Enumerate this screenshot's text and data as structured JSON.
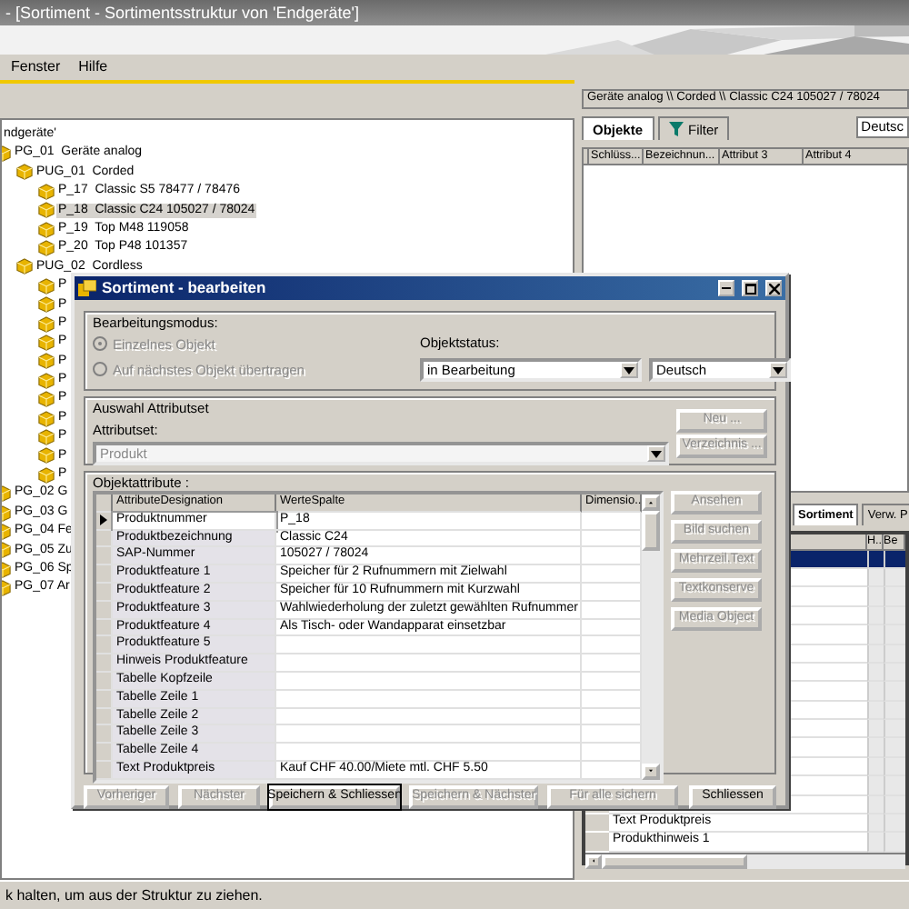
{
  "window": {
    "title": "- [Sortiment - Sortimentsstruktur von 'Endgeräte']"
  },
  "menu": [
    {
      "label": "Fenster"
    },
    {
      "label": "Hilfe"
    }
  ],
  "tree": {
    "header": "ndgeräte'",
    "items": [
      {
        "label": "PG_01  Geräte analog",
        "selected": false,
        "children": [
          {
            "label": "PUG_01  Corded",
            "selected": false,
            "children": [
              {
                "label": "P_17  Classic S5 78477 / 78476",
                "selected": false
              },
              {
                "label": "P_18  Classic C24 105027 / 78024",
                "selected": true
              },
              {
                "label": "P_19  Top M48 119058",
                "selected": false
              },
              {
                "label": "P_20  Top P48 101357",
                "selected": false
              }
            ]
          },
          {
            "label": "PUG_02  Cordless",
            "selected": false,
            "children": [
              {
                "label": "P",
                "selected": false
              },
              {
                "label": "P",
                "selected": false
              },
              {
                "label": "P",
                "selected": false
              },
              {
                "label": "P",
                "selected": false
              },
              {
                "label": "P",
                "selected": false
              },
              {
                "label": "P",
                "selected": false
              },
              {
                "label": "P",
                "selected": false
              },
              {
                "label": "P",
                "selected": false
              },
              {
                "label": "P",
                "selected": false
              },
              {
                "label": "P",
                "selected": false
              },
              {
                "label": "P",
                "selected": false
              }
            ]
          }
        ]
      },
      {
        "label": "PG_02 G",
        "selected": false
      },
      {
        "label": "PG_03 G",
        "selected": false
      },
      {
        "label": "PG_04 Fe",
        "selected": false
      },
      {
        "label": "PG_05 Zu",
        "selected": false
      },
      {
        "label": "PG_06 Sp",
        "selected": false
      },
      {
        "label": "PG_07 Ar",
        "selected": false
      }
    ]
  },
  "objects_panel": {
    "path": "Geräte analog \\\\ Corded \\\\ Classic C24 105027 / 78024",
    "tabs": [
      {
        "label": "Objekte",
        "selected": true
      },
      {
        "label": "Filter",
        "selected": false
      }
    ],
    "language": "Deutsc",
    "columns": [
      "Schlüss...",
      "Bezeichnun...",
      "Attribut 3",
      "Attribut 4"
    ]
  },
  "attributes_panel": {
    "tabs": [
      {
        "label": "Sortiment",
        "selected": true
      },
      {
        "label": "Verw. P",
        "selected": false
      }
    ],
    "columns": [
      "H..",
      "Be"
    ],
    "rows": [
      {
        "selected": true
      },
      {
        "selected": false
      },
      {
        "selected": false
      },
      {
        "selected": false
      },
      {
        "selected": false
      },
      {
        "selected": false
      },
      {
        "selected": false
      },
      {
        "selected": false
      },
      {
        "selected": false
      },
      {
        "selected": false
      },
      {
        "selected": false
      },
      {
        "selected": false
      },
      {
        "selected": false
      },
      {
        "selected": false
      },
      {
        "text": "Text Produktpreis",
        "selected": false
      },
      {
        "text": "Produkthinweis 1",
        "selected": false
      }
    ]
  },
  "dialog": {
    "title": "Sortiment - bearbeiten",
    "mode": {
      "legend": "Bearbeitungsmodus:",
      "options": [
        {
          "label": "Einzelnes Objekt",
          "selected": true,
          "disabled": true
        },
        {
          "label": "Auf nächstes Objekt übertragen",
          "selected": false,
          "disabled": true
        }
      ]
    },
    "status": {
      "label": "Objektstatus:",
      "value": "in Bearbeitung"
    },
    "language": {
      "value": "Deutsch"
    },
    "attributset": {
      "legend": "Auswahl Attributset",
      "label": "Attributset:",
      "value": "Produkt",
      "disabled": true,
      "buttons": [
        {
          "label": "Neu ...",
          "disabled": true
        },
        {
          "label": "Verzeichnis ...",
          "disabled": true
        }
      ]
    },
    "attributes": {
      "legend": "Objektattribute :",
      "columns": [
        "AttributeDesignation",
        "WerteSpalte",
        "Dimensio.."
      ],
      "rows": [
        {
          "name": "Produktnummer",
          "value": "P_18",
          "current": true
        },
        {
          "name": "Produktbezeichnung",
          "value": "Classic C24",
          "current": false
        },
        {
          "name": "SAP-Nummer",
          "value": "105027 / 78024",
          "current": false
        },
        {
          "name": "Produktfeature 1",
          "value": "Speicher für 2 Rufnummern mit Zielwahl",
          "current": false
        },
        {
          "name": "Produktfeature 2",
          "value": "Speicher für 10 Rufnummern mit Kurzwahl",
          "current": false
        },
        {
          "name": "Produktfeature 3",
          "value": "Wahlwiederholung der zuletzt gewählten Rufnummer",
          "current": false
        },
        {
          "name": "Produktfeature 4",
          "value": "Als Tisch- oder Wandapparat einsetzbar",
          "current": false
        },
        {
          "name": "Produktfeature 5",
          "current": false
        },
        {
          "name": "Hinweis Produktfeature",
          "current": false
        },
        {
          "name": "Tabelle Kopfzeile",
          "current": false
        },
        {
          "name": "Tabelle Zeile 1",
          "current": false
        },
        {
          "name": "Tabelle Zeile 2",
          "current": false
        },
        {
          "name": "Tabelle Zeile 3",
          "current": false
        },
        {
          "name": "Tabelle Zeile 4",
          "current": false
        },
        {
          "name": "Text Produktpreis",
          "value": "Kauf CHF 40.00/Miete mtl. CHF 5.50",
          "current": false
        }
      ],
      "buttons": [
        {
          "label": "Ansehen",
          "disabled": true
        },
        {
          "label": "Bild suchen",
          "disabled": true
        },
        {
          "label": "Mehrzeil.Text",
          "disabled": true
        },
        {
          "label": "Textkonserve",
          "disabled": true
        },
        {
          "label": "Media Object",
          "disabled": true
        }
      ]
    },
    "buttons": [
      {
        "label": "Vorheriger",
        "disabled": true,
        "default": false
      },
      {
        "label": "Nächster",
        "disabled": true,
        "default": false
      },
      {
        "label": "Speichern & Schliessen",
        "disabled": false,
        "default": true
      },
      {
        "label": "Speichern & Nächster",
        "disabled": true,
        "default": false
      },
      {
        "label": "Für alle sichern",
        "disabled": true,
        "default": false
      },
      {
        "label": "Schliessen",
        "disabled": false,
        "default": false
      }
    ]
  },
  "status_bar": "k halten, um aus der Struktur zu ziehen."
}
